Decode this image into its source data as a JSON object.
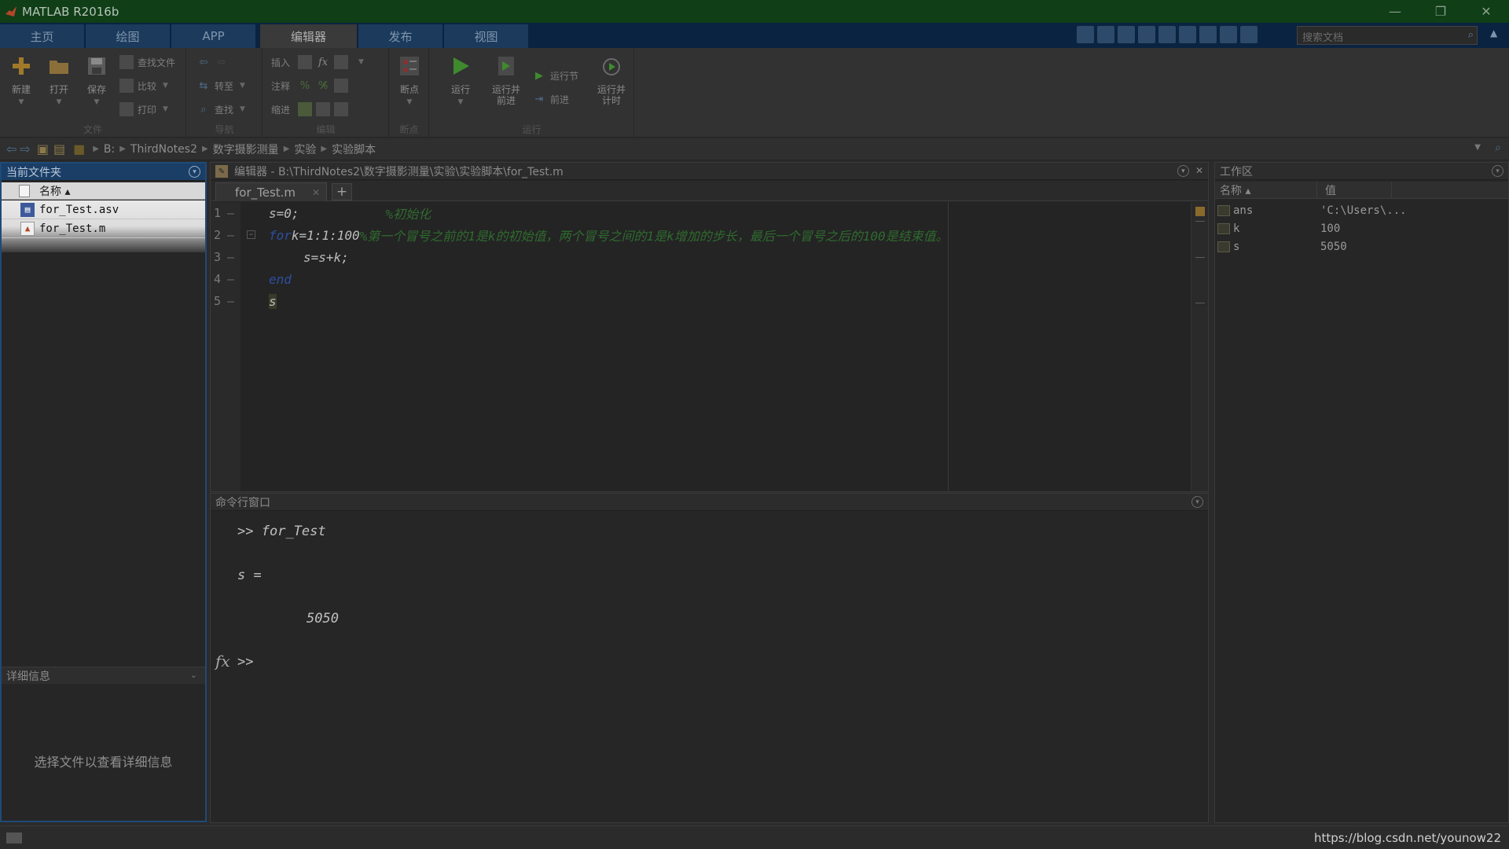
{
  "window": {
    "title": "MATLAB R2016b",
    "controls": [
      "—",
      "❐",
      "✕"
    ]
  },
  "ribbon": {
    "tabs": [
      {
        "label": "主页",
        "active": false
      },
      {
        "label": "绘图",
        "active": false
      },
      {
        "label": "APP",
        "active": false
      },
      {
        "label": "编辑器",
        "active": true
      },
      {
        "label": "发布",
        "active": false
      },
      {
        "label": "视图",
        "active": false
      }
    ],
    "search_placeholder": "搜索文档"
  },
  "toolstrip": {
    "file": {
      "group_label": "文件",
      "new": "新建",
      "open": "打开",
      "save": "保存",
      "find_files": "查找文件",
      "compare": "比较",
      "print": "打印"
    },
    "navigate": {
      "group_label": "导航",
      "goto": "转至",
      "find": "查找"
    },
    "edit": {
      "group_label": "编辑",
      "insert": "插入",
      "comment": "注释",
      "indent": "缩进",
      "fx": "fx"
    },
    "breakpoints": {
      "group_label": "断点",
      "breakpoints": "断点"
    },
    "run": {
      "group_label": "运行",
      "run": "运行",
      "run_advance_line1": "运行并",
      "run_advance_line2": "前进",
      "run_section": "运行节",
      "advance": "前进",
      "run_time_line1": "运行并",
      "run_time_line2": "计时"
    }
  },
  "address": {
    "crumbs": [
      "B:",
      "ThirdNotes2",
      "数字摄影测量",
      "实验",
      "实验脚本"
    ]
  },
  "current_folder": {
    "title": "当前文件夹",
    "column_name": "名称 ▴",
    "files": [
      {
        "name": "for_Test.asv",
        "icon": "asv-file-icon"
      },
      {
        "name": "for_Test.m",
        "icon": "m-file-icon"
      }
    ],
    "details_title": "详细信息",
    "details_message": "选择文件以查看详细信息"
  },
  "editor": {
    "title": "编辑器 - B:\\ThirdNotes2\\数字摄影测量\\实验\\实验脚本\\for_Test.m",
    "tab": "for_Test.m",
    "lines": [
      {
        "num": "1",
        "code": "s=0;",
        "comment": "%初始化",
        "keyword": ""
      },
      {
        "num": "2",
        "keyword": "for",
        "code": " k=1:1:100",
        "comment": " %第一个冒号之前的1是k的初始值，两个冒号之间的1是k增加的步长，最后一个冒号之后的100是结束值。"
      },
      {
        "num": "3",
        "code": "s=s+k;",
        "comment": "",
        "keyword": ""
      },
      {
        "num": "4",
        "keyword": "end",
        "code": "",
        "comment": ""
      },
      {
        "num": "5",
        "code": "s",
        "comment": "",
        "keyword": ""
      }
    ]
  },
  "command_window": {
    "title": "命令行窗口",
    "prompt": ">>",
    "command": "for_Test",
    "output_var": "s =",
    "output_value": "5050",
    "fx": "fx"
  },
  "workspace": {
    "title": "工作区",
    "col_name": "名称 ▴",
    "col_value": "值",
    "vars": [
      {
        "name": "ans",
        "value": "'C:\\Users\\..."
      },
      {
        "name": "k",
        "value": "100"
      },
      {
        "name": "s",
        "value": "5050"
      }
    ]
  },
  "watermark": "https://blog.csdn.net/younow22",
  "colors": {
    "titlebar": "#0f3e17",
    "tabbar": "#0a2340",
    "keyword": "#2c4fa0",
    "comment": "#2f6b2f",
    "panel_active": "#1a3e66"
  }
}
